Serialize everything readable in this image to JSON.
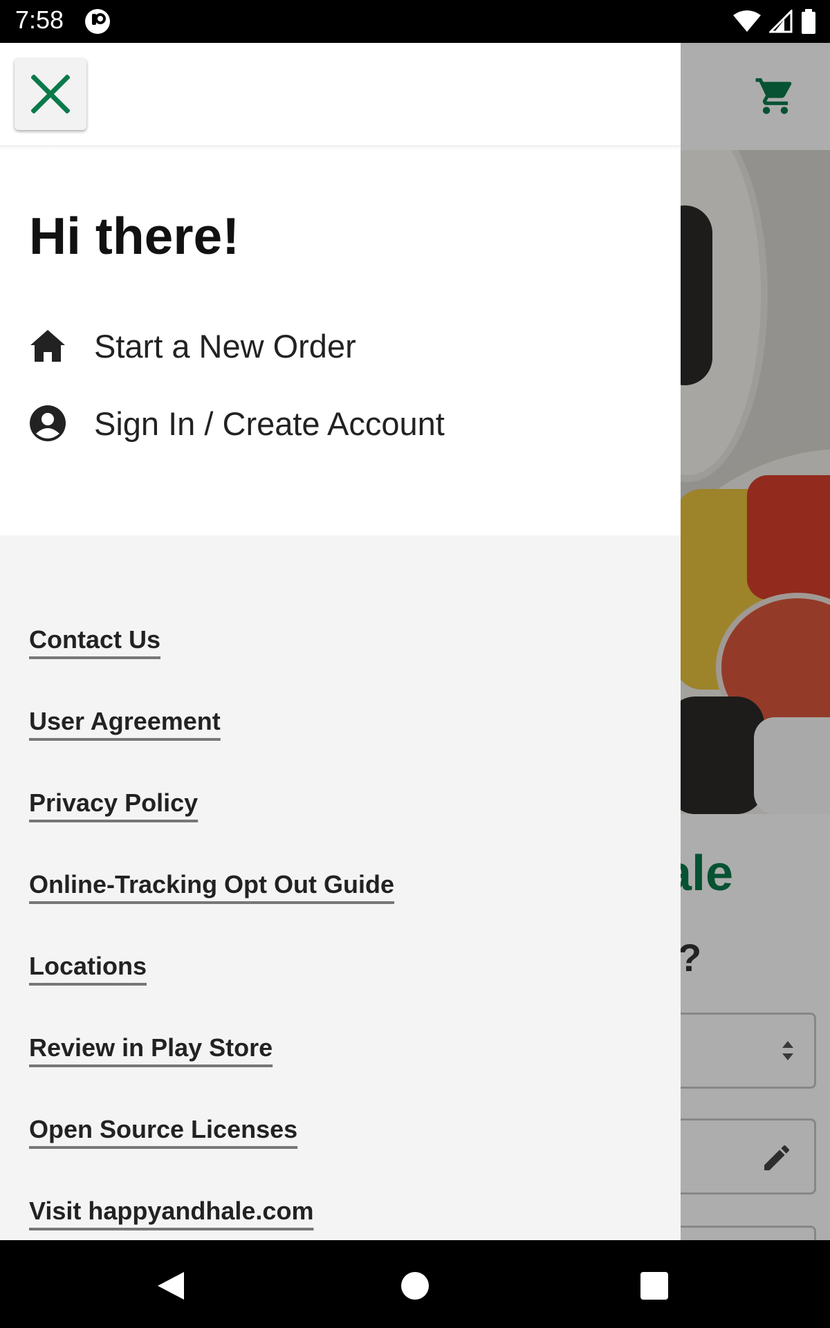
{
  "status_bar": {
    "time": "7:58",
    "icons": [
      "app-notification-icon",
      "wifi-icon",
      "signal-icon",
      "battery-icon"
    ]
  },
  "background_screen": {
    "title_partial": "ale",
    "question_partial": "?",
    "cart_icon": "cart-icon",
    "brand_color": "#0a7a4a"
  },
  "drawer": {
    "close_icon": "close-icon",
    "close_color": "#0a7a4a",
    "greeting": "Hi there!",
    "menu_items": [
      {
        "label": "Start a New Order",
        "icon": "home-icon"
      },
      {
        "label": "Sign In / Create Account",
        "icon": "account-circle-icon"
      }
    ],
    "links": [
      {
        "label": "Contact Us"
      },
      {
        "label": "User Agreement"
      },
      {
        "label": "Privacy Policy"
      },
      {
        "label": "Online-Tracking Opt Out Guide"
      },
      {
        "label": "Locations"
      },
      {
        "label": "Review in Play Store"
      },
      {
        "label": "Open Source Licenses"
      },
      {
        "label": "Visit happyandhale.com"
      }
    ]
  },
  "nav_bar": {
    "buttons": [
      "back-icon",
      "home-circle-icon",
      "recents-icon"
    ]
  }
}
